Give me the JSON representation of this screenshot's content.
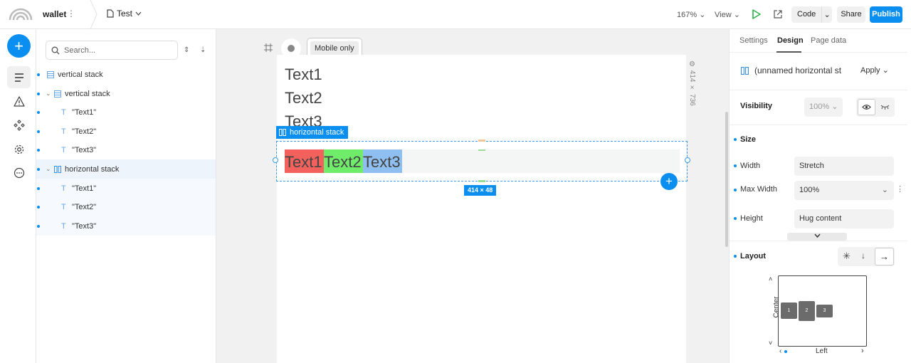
{
  "topbar": {
    "project_name": "wallet",
    "project_menu": "⋮",
    "page_name": "Test",
    "zoom": "167%",
    "view": "View",
    "code": "Code",
    "share": "Share",
    "publish": "Publish"
  },
  "tree": {
    "search_placeholder": "Search...",
    "rows": [
      {
        "label": "vertical stack"
      },
      {
        "label": "vertical stack"
      },
      {
        "label": "\"Text1\""
      },
      {
        "label": "\"Text2\""
      },
      {
        "label": "\"Text3\""
      },
      {
        "label": "horizontal stack"
      },
      {
        "label": "\"Text1\""
      },
      {
        "label": "\"Text2\""
      },
      {
        "label": "\"Text3\""
      }
    ]
  },
  "canvas": {
    "mobile_chip": "Mobile only",
    "texts": [
      "Text1",
      "Text2",
      "Text3"
    ],
    "hstack_label": "horizontal stack",
    "hstack_items": [
      "Text1",
      "Text2",
      "Text3"
    ],
    "size_badge": "414 × 48",
    "frame_dims": "414 × 736",
    "colors": {
      "text1_bg": "#f2615c",
      "text2_bg": "#6fed6a",
      "text3_bg": "#8fbff0",
      "accent": "#0a8ff0"
    }
  },
  "right_panel": {
    "tabs": [
      "Settings",
      "Design",
      "Page data"
    ],
    "active_tab": "Design",
    "component_name": "(unnamed horizontal st",
    "apply": "Apply",
    "visibility_label": "Visibility",
    "visibility_value": "100%",
    "size_title": "Size",
    "width_label": "Width",
    "width_value": "Stretch",
    "max_width_label": "Max Width",
    "max_width_value": "100%",
    "height_label": "Height",
    "height_value": "Hug content",
    "layout_title": "Layout",
    "align_vertical": "Center",
    "align_horizontal": "Left",
    "layout_boxes": [
      "1",
      "2",
      "3"
    ]
  }
}
